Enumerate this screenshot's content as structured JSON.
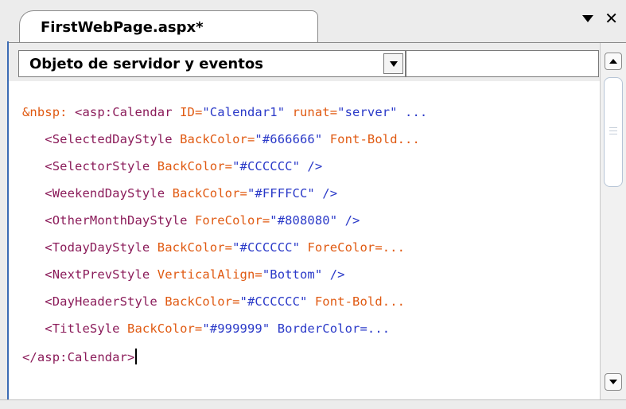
{
  "tab": {
    "title": "FirstWebPage.aspx*"
  },
  "panel": {
    "menu_icon": "dropdown-triangle-icon",
    "close_icon": "close-icon",
    "close_glyph": "✕"
  },
  "toolbar": {
    "object_select_value": "Objeto de servidor y eventos",
    "search_value": ""
  },
  "code_lines": [
    [
      {
        "t": "&nbsp: ",
        "c": "ent"
      },
      {
        "t": "<asp:Calendar ",
        "c": "tag"
      },
      {
        "t": "ID=",
        "c": "attr"
      },
      {
        "t": "\"Calendar1\" ",
        "c": "val"
      },
      {
        "t": "runat=",
        "c": "attr"
      },
      {
        "t": "\"server\" ...",
        "c": "val"
      }
    ],
    [
      {
        "t": "   <SelectedDayStyle ",
        "c": "tag"
      },
      {
        "t": "BackColor=",
        "c": "attr"
      },
      {
        "t": "\"#666666\" ",
        "c": "val"
      },
      {
        "t": "Font-Bold...",
        "c": "attr"
      }
    ],
    [
      {
        "t": "   <SelectorStyle ",
        "c": "tag"
      },
      {
        "t": "BackColor=",
        "c": "attr"
      },
      {
        "t": "\"#CCCCCC\" />",
        "c": "val"
      }
    ],
    [
      {
        "t": "   <WeekendDayStyle ",
        "c": "tag"
      },
      {
        "t": "BackColor=",
        "c": "attr"
      },
      {
        "t": "\"#FFFFCC\" />",
        "c": "val"
      }
    ],
    [
      {
        "t": "   <OtherMonthDayStyle ",
        "c": "tag"
      },
      {
        "t": "ForeColor=",
        "c": "attr"
      },
      {
        "t": "\"#808080\" />",
        "c": "val"
      }
    ],
    [
      {
        "t": "   <TodayDayStyle ",
        "c": "tag"
      },
      {
        "t": "BackColor=",
        "c": "attr"
      },
      {
        "t": "\"#CCCCCC\" ",
        "c": "val"
      },
      {
        "t": "ForeColor=...",
        "c": "attr"
      }
    ],
    [
      {
        "t": "   <NextPrevStyle ",
        "c": "tag"
      },
      {
        "t": "VerticalAlign=",
        "c": "attr"
      },
      {
        "t": "\"Bottom\" />",
        "c": "val"
      }
    ],
    [
      {
        "t": "   <DayHeaderStyle ",
        "c": "tag"
      },
      {
        "t": "BackColor=",
        "c": "attr"
      },
      {
        "t": "\"#CCCCCC\" ",
        "c": "val"
      },
      {
        "t": "Font-Bold...",
        "c": "attr"
      }
    ],
    [
      {
        "t": "   <TitleSyle ",
        "c": "tag"
      },
      {
        "t": "BackColor=",
        "c": "attr"
      },
      {
        "t": "\"#999999\" ",
        "c": "val"
      },
      {
        "t": "BorderColor=...",
        "c": "plain"
      }
    ],
    [
      {
        "t": "</asp:Calendar>",
        "c": "tag"
      }
    ]
  ],
  "colors": {
    "entity": "#e05a12",
    "tag": "#8b1c5a",
    "attribute": "#e05a12",
    "value": "#2a39c8",
    "frame_accent": "#3b6bb5"
  }
}
